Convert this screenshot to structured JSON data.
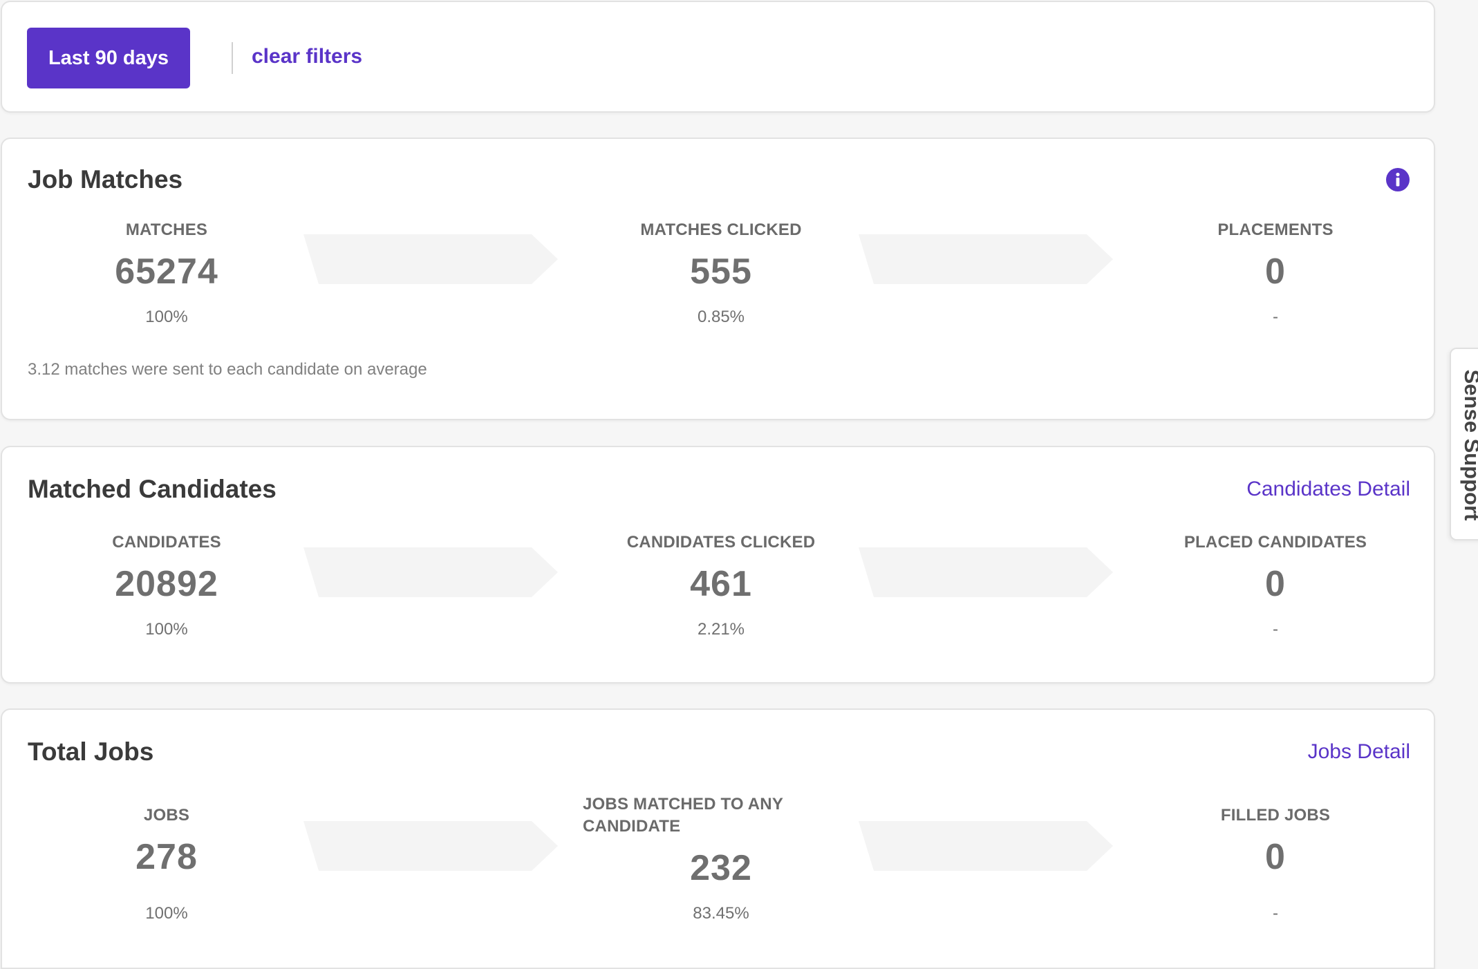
{
  "filter": {
    "date_range_label": "Last 90 days",
    "clear_label": "clear filters"
  },
  "job_matches": {
    "title": "Job Matches",
    "info_icon": "info-circle-icon",
    "metrics": [
      {
        "label": "MATCHES",
        "value": "65274",
        "pct": "100%"
      },
      {
        "label": "MATCHES CLICKED",
        "value": "555",
        "pct": "0.85%"
      },
      {
        "label": "PLACEMENTS",
        "value": "0",
        "pct": "-"
      }
    ],
    "note": "3.12 matches were sent to each candidate on average"
  },
  "matched_candidates": {
    "title": "Matched Candidates",
    "detail_link": "Candidates Detail",
    "metrics": [
      {
        "label": "CANDIDATES",
        "value": "20892",
        "pct": "100%"
      },
      {
        "label": "CANDIDATES CLICKED",
        "value": "461",
        "pct": "2.21%"
      },
      {
        "label": "PLACED CANDIDATES",
        "value": "0",
        "pct": "-"
      }
    ]
  },
  "total_jobs": {
    "title": "Total Jobs",
    "detail_link": "Jobs Detail",
    "metrics": [
      {
        "label": "JOBS",
        "value": "278",
        "pct": "100%"
      },
      {
        "label_line1": "JOBS MATCHED TO ANY",
        "label_line2": "CANDIDATE",
        "value": "232",
        "pct": "83.45%"
      },
      {
        "label": "FILLED JOBS",
        "value": "0",
        "pct": "-"
      }
    ]
  },
  "support": {
    "label": "Sense Support"
  },
  "colors": {
    "accent": "#5a34c8",
    "card_background": "#ffffff",
    "page_background": "#f6f6f6",
    "funnel_arrow": "#f4f4f4"
  }
}
